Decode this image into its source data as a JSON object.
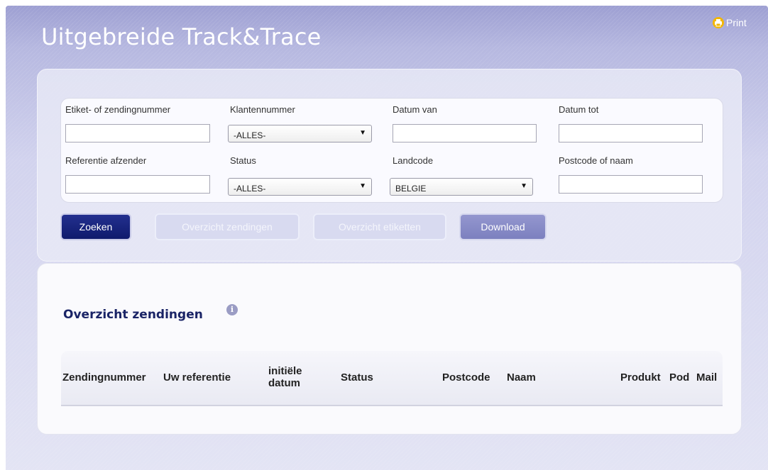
{
  "header": {
    "title": "Uitgebreide Track&Trace",
    "print_label": "Print"
  },
  "search": {
    "fields": {
      "etiket_label": "Etiket- of zendingnummer",
      "etiket_value": "",
      "klantennummer_label": "Klantennummer",
      "klantennummer_selected": "-ALLES-",
      "datum_van_label": "Datum van",
      "datum_van_value": "",
      "datum_tot_label": "Datum tot",
      "datum_tot_value": "",
      "referentie_label": "Referentie afzender",
      "referentie_value": "",
      "status_label": "Status",
      "status_selected": "-ALLES-",
      "landcode_label": "Landcode",
      "landcode_selected": "BELGIE",
      "postcode_label": "Postcode of naam",
      "postcode_value": ""
    },
    "buttons": {
      "zoeken": "Zoeken",
      "overzicht_zendingen": "Overzicht zendingen",
      "overzicht_etiketten": "Overzicht etiketten",
      "download": "Download"
    }
  },
  "results": {
    "title": "Overzicht zendingen",
    "columns": {
      "zendingnummer": "Zendingnummer",
      "uw_referentie": "Uw referentie",
      "initiele_datum_line1": "initiële",
      "initiele_datum_line2": "datum",
      "status": "Status",
      "postcode": "Postcode",
      "naam": "Naam",
      "produkt": "Produkt",
      "pod": "Pod",
      "mail": "Mail"
    },
    "rows": []
  },
  "icons": {
    "print": "printer-icon",
    "info": "info-icon",
    "dropdown": "triangle-down-icon"
  },
  "colors": {
    "primary_button": "#14207a",
    "title_text": "#1a2466",
    "print_icon": "#f2b600"
  }
}
